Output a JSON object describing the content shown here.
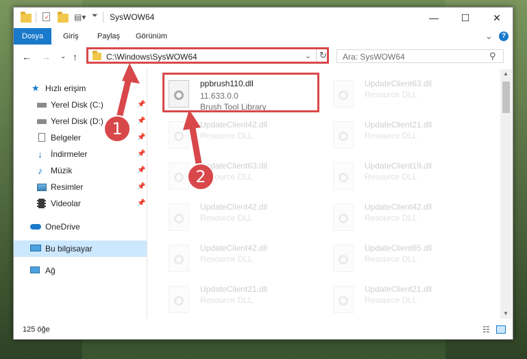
{
  "window": {
    "title": "SysWOW64",
    "minimize": "—",
    "maximize": "☐",
    "close": "✕"
  },
  "ribbon": {
    "tabs": [
      "Dosya",
      "Giriş",
      "Paylaş",
      "Görünüm"
    ],
    "help": "?",
    "expand": "⌄"
  },
  "address": {
    "path": "C:\\Windows\\SysWOW64",
    "search_placeholder": "Ara: SysWOW64"
  },
  "sidebar": {
    "quick_access": "Hızlı erişim",
    "items": [
      {
        "label": "Yerel Disk (C:)",
        "icon": "drive-icon"
      },
      {
        "label": "Yerel Disk (D:)",
        "icon": "drive-icon"
      },
      {
        "label": "Belgeler",
        "icon": "documents-icon"
      },
      {
        "label": "İndirmeler",
        "icon": "downloads-icon"
      },
      {
        "label": "Müzik",
        "icon": "music-icon"
      },
      {
        "label": "Resimler",
        "icon": "pictures-icon"
      },
      {
        "label": "Videolar",
        "icon": "videos-icon"
      }
    ],
    "onedrive": "OneDrive",
    "this_pc": "Bu bilgisayar",
    "network": "Ağ"
  },
  "files": {
    "highlighted": {
      "name": "ppbrush110.dll",
      "version": "11.633.0.0",
      "description": "Brush Tool Library"
    },
    "right_column": [
      {
        "name": "UpdateClient63.dll",
        "type": "Resource DLL"
      },
      {
        "name": "UpdateClient21.dll",
        "type": "Resource DLL"
      },
      {
        "name": "UpdateClient19.dll",
        "type": "Resource DLL"
      },
      {
        "name": "UpdateClient42.dll",
        "type": "Resource DLL"
      },
      {
        "name": "UpdateClient65.dll",
        "type": "Resource DLL"
      },
      {
        "name": "UpdateClient21.dll",
        "type": "Resource DLL"
      }
    ],
    "left_column": [
      {
        "name": "UpdateClient42.dll",
        "type": "Resource DLL"
      },
      {
        "name": "UpdateClient63.dll",
        "type": "Resource DLL"
      },
      {
        "name": "UpdateClient42.dll",
        "type": "Resource DLL"
      },
      {
        "name": "UpdateClient42.dll",
        "type": "Resource DLL"
      },
      {
        "name": "UpdateClient21.dll",
        "type": "Resource DLL"
      }
    ]
  },
  "status": {
    "count": "125 öğe"
  },
  "annotations": {
    "step1": "1",
    "step2": "2"
  },
  "colors": {
    "accent": "#1979ca",
    "highlight": "#d8474a",
    "selection": "#cce8ff"
  }
}
